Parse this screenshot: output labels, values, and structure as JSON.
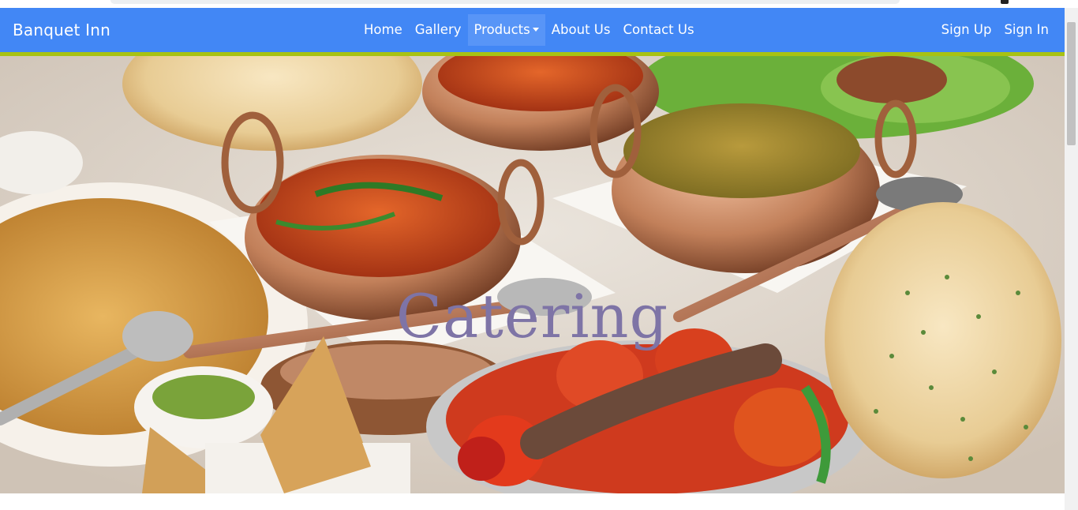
{
  "navbar": {
    "brand": "Banquet Inn",
    "links": [
      {
        "label": "Home"
      },
      {
        "label": "Gallery"
      },
      {
        "label": "Products",
        "dropdown": true,
        "active": true
      },
      {
        "label": "About Us"
      },
      {
        "label": "Contact Us"
      }
    ],
    "auth": {
      "signup": "Sign Up",
      "signin": "Sign In"
    },
    "colors": {
      "bar": "#4287f5",
      "underline": "#a8c213"
    }
  },
  "hero": {
    "title": "Catering",
    "image": "indian-catering-food-photo"
  }
}
